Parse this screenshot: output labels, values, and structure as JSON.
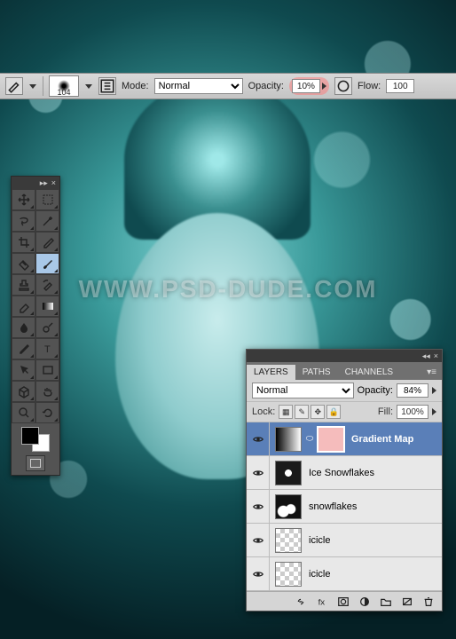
{
  "watermark": "WWW.PSD-DUDE.COM",
  "options_bar": {
    "brush_size": "104",
    "mode_label": "Mode:",
    "mode_value": "Normal",
    "opacity_label": "Opacity:",
    "opacity_value": "10%",
    "flow_label": "Flow:",
    "flow_value": "100"
  },
  "tools": {
    "swatch_fg": "#000000",
    "swatch_bg": "#ffffff",
    "items": [
      "move",
      "marquee",
      "lasso",
      "wand",
      "crop",
      "eyedropper",
      "healing",
      "brush",
      "stamp",
      "history-brush",
      "eraser",
      "gradient",
      "blur",
      "dodge",
      "pen",
      "type",
      "path-select",
      "shape",
      "3d",
      "hand",
      "zoom",
      "rotate-view"
    ],
    "active": "brush"
  },
  "layers_panel": {
    "tabs": [
      "LAYERS",
      "PATHS",
      "CHANNELS"
    ],
    "active_tab": "LAYERS",
    "blend_mode": "Normal",
    "opacity_label": "Opacity:",
    "opacity_value": "84%",
    "lock_label": "Lock:",
    "fill_label": "Fill:",
    "fill_value": "100%",
    "layers": [
      {
        "name": "Gradient Map",
        "visible": true,
        "selected": true,
        "thumb": "grad",
        "mask": "mask-pink"
      },
      {
        "name": "Ice Snowflakes",
        "visible": true,
        "selected": false,
        "thumb": "flake-dark",
        "mask": null
      },
      {
        "name": "snowflakes",
        "visible": true,
        "selected": false,
        "thumb": "snow",
        "mask": null
      },
      {
        "name": "icicle",
        "visible": true,
        "selected": false,
        "thumb": "checker",
        "mask": null
      },
      {
        "name": "icicle",
        "visible": true,
        "selected": false,
        "thumb": "checker",
        "mask": null
      }
    ]
  }
}
